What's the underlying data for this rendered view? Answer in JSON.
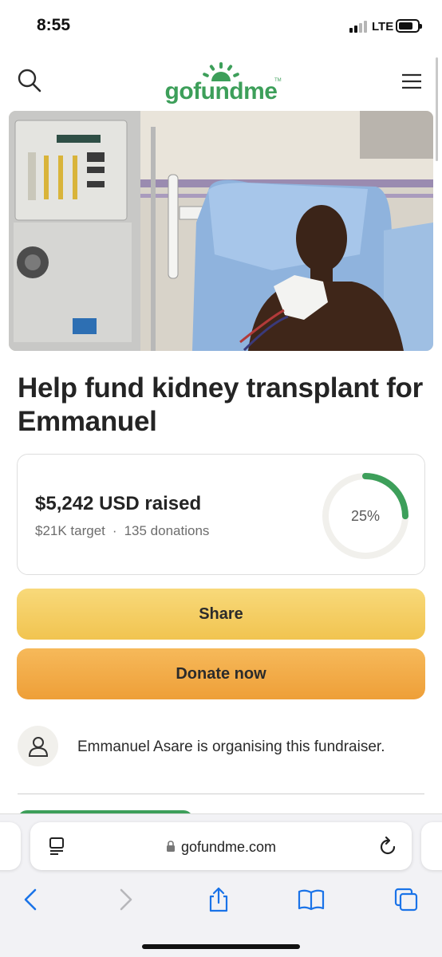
{
  "status_bar": {
    "time": "8:55",
    "network": "LTE",
    "signal_bars_active": 2,
    "signal_bars_total": 4
  },
  "header": {
    "logo_text": "gofundme",
    "logo_mark": "TM",
    "brand_color": "#3d9f5a"
  },
  "hero_image": {
    "alt": "Emmanuel in hospital bed beside a dialysis machine"
  },
  "campaign": {
    "title": "Help fund kidney transplant for Emmanuel"
  },
  "progress": {
    "raised": "$5,242 USD raised",
    "target": "$21K target",
    "separator": "·",
    "donations": "135 donations",
    "percent_label": "25%",
    "percent_value": 0.25,
    "ring_color": "#3d9f5a",
    "track_color": "#f1f0ec"
  },
  "actions": {
    "share_label": "Share",
    "donate_label": "Donate now"
  },
  "organiser": {
    "text": "Emmanuel Asare is organising this fundraiser."
  },
  "browser": {
    "url": "gofundme.com",
    "accent_color": "#1a73e8"
  }
}
